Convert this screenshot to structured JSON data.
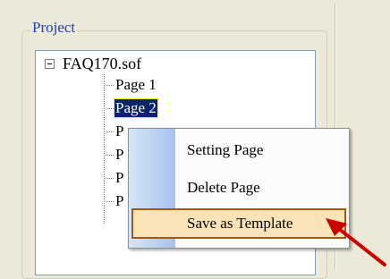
{
  "group": {
    "title": "Project"
  },
  "tree": {
    "root": {
      "label": "FAQ170.sof",
      "expanded": true
    },
    "children": [
      {
        "label": "Page 1",
        "selected": false
      },
      {
        "label": "Page 2",
        "selected": true
      },
      {
        "label": "P",
        "selected": false
      },
      {
        "label": "P",
        "selected": false
      },
      {
        "label": "P",
        "selected": false
      },
      {
        "label": "P",
        "selected": false
      }
    ]
  },
  "context_menu": {
    "items": [
      {
        "label": "Setting Page",
        "highlighted": false
      },
      {
        "label": "Delete Page",
        "highlighted": false
      },
      {
        "label": "Save as Template",
        "highlighted": true
      }
    ]
  },
  "annotation": {
    "arrow_color": "#cc0000"
  },
  "colors": {
    "selection": "#0a246a",
    "menu_highlight": "#fbe3b8",
    "menu_highlight_border": "#a05a1a",
    "group_title": "#1a40cc"
  }
}
